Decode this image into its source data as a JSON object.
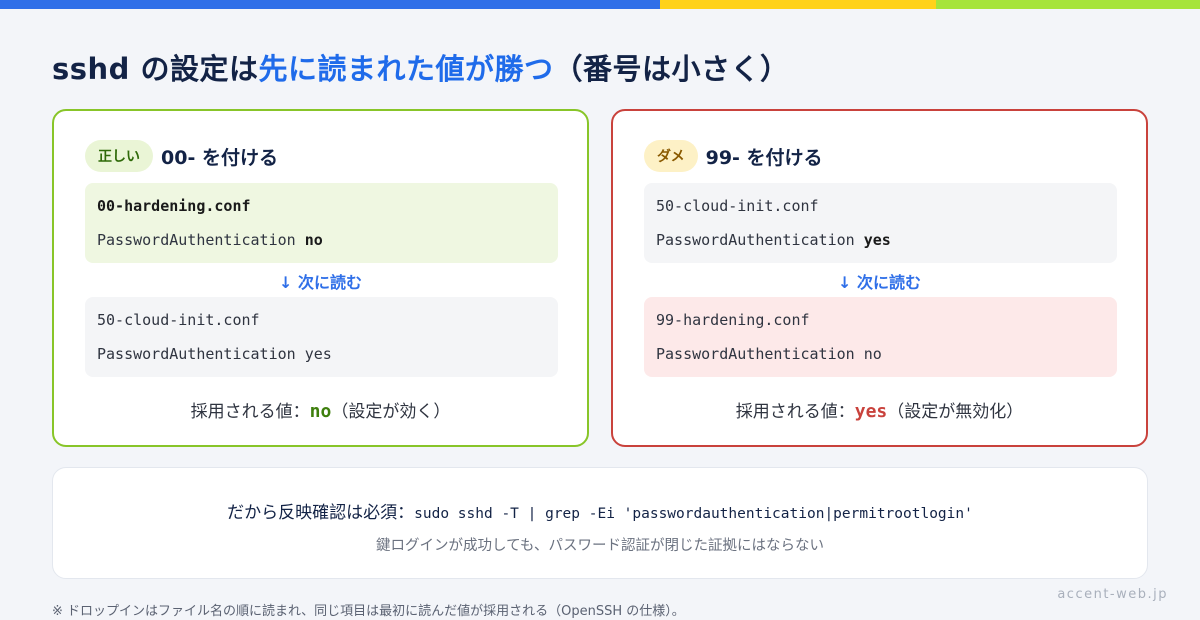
{
  "title": {
    "part1": "sshd の設定は",
    "highlight": "先に読まれた値が勝つ",
    "part2": "（番号は小さく）"
  },
  "colors": {
    "accent_blue": "#1f6bea",
    "good_border": "#88c529",
    "bad_border": "#c9423c"
  },
  "good": {
    "badge": "正しい",
    "heading": "00- を付ける",
    "first": {
      "file": "00-hardening.conf",
      "directive": "PasswordAuthentication",
      "value": "no"
    },
    "arrow": "↓ 次に読む",
    "second": {
      "file": "50-cloud-init.conf",
      "directive": "PasswordAuthentication",
      "value": "yes"
    },
    "result_label": "採用される値：",
    "result_value": "no",
    "result_note": "（設定が効く）"
  },
  "bad": {
    "badge": "ダメ",
    "heading": "99- を付ける",
    "first": {
      "file": "50-cloud-init.conf",
      "directive": "PasswordAuthentication",
      "value": "yes"
    },
    "arrow": "↓ 次に読む",
    "second": {
      "file": "99-hardening.conf",
      "directive": "PasswordAuthentication",
      "value": "no"
    },
    "result_label": "採用される値：",
    "result_value": "yes",
    "result_note": "（設定が無効化）"
  },
  "bottom": {
    "lead": "だから反映確認は必須：",
    "command": "sudo sshd -T | grep -Ei 'passwordauthentication|permitrootlogin'",
    "sub": "鍵ログインが成功しても、パスワード認証が閉じた証拠にはならない"
  },
  "footnote": "※ ドロップインはファイル名の順に読まれ、同じ項目は最初に読んだ値が採用される（OpenSSH の仕様）。",
  "brand": "accent-web.jp"
}
